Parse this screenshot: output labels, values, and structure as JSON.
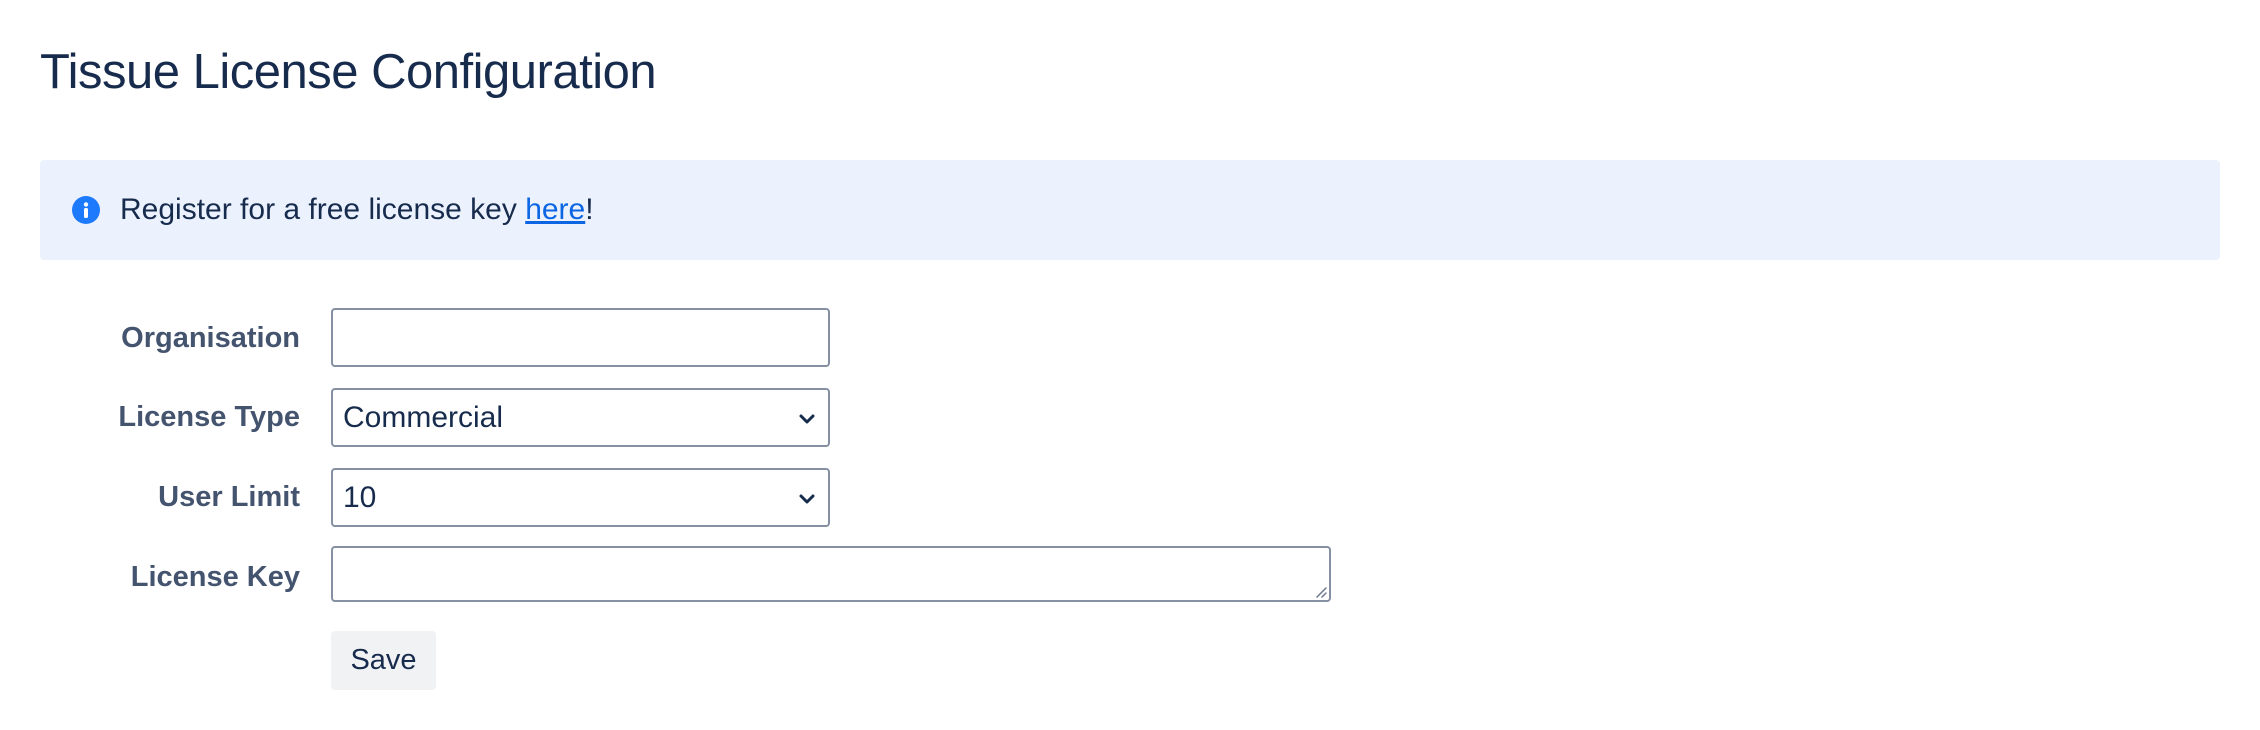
{
  "page": {
    "title": "Tissue License Configuration"
  },
  "banner": {
    "icon": "info-icon",
    "text_before": "Register for a free license key ",
    "link_text": "here",
    "text_after": "!",
    "background": "#ebf2fd",
    "icon_color": "#1d7afc"
  },
  "form": {
    "organisation": {
      "label": "Organisation",
      "value": "",
      "placeholder": ""
    },
    "license_type": {
      "label": "License Type",
      "selected": "Commercial",
      "icon": "chevron-down-icon"
    },
    "user_limit": {
      "label": "User Limit",
      "selected": "10",
      "icon": "chevron-down-icon"
    },
    "license_key": {
      "label": "License Key",
      "value": ""
    },
    "save_label": "Save"
  }
}
